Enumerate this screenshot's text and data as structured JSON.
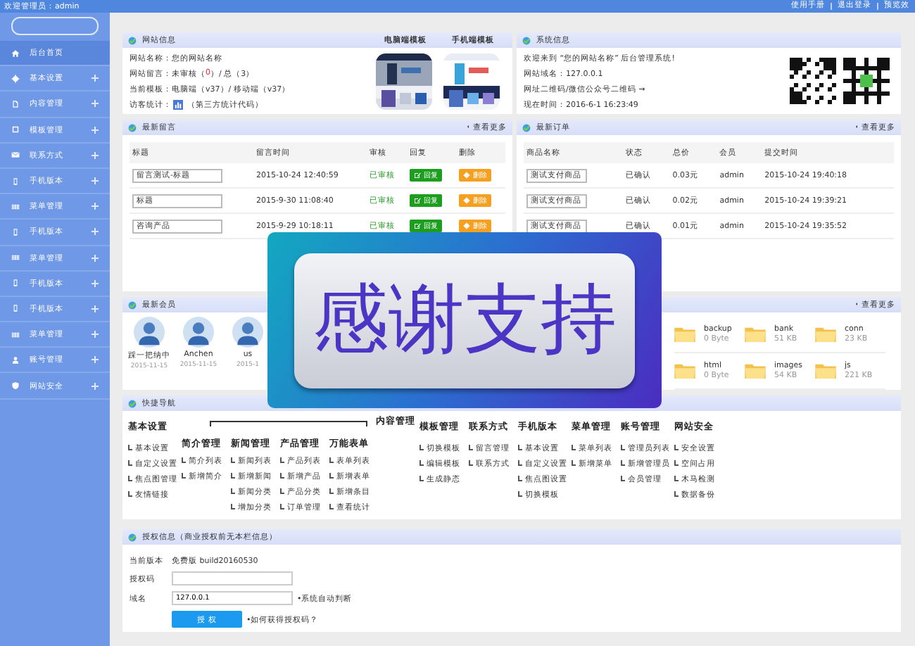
{
  "topbar": {
    "welcome": "欢迎管理员：admin",
    "links": [
      "使用手册",
      "退出登录",
      "预览效"
    ]
  },
  "sidebar": {
    "items": [
      {
        "label": "后台首页",
        "kind": "home",
        "selected": true,
        "expandable": false
      },
      {
        "label": "基本设置",
        "kind": "gear",
        "selected": false,
        "expandable": true
      },
      {
        "label": "内容管理",
        "kind": "document",
        "selected": false,
        "expandable": true
      },
      {
        "label": "模板管理",
        "kind": "frame",
        "selected": false,
        "expandable": true
      },
      {
        "label": "联系方式",
        "kind": "mail",
        "selected": false,
        "expandable": true
      },
      {
        "label": "手机版本",
        "kind": "phone",
        "selected": false,
        "expandable": true
      },
      {
        "label": "菜单管理",
        "kind": "grid",
        "selected": false,
        "expandable": true
      },
      {
        "label": "手机版本",
        "kind": "phone",
        "selected": false,
        "expandable": true
      },
      {
        "label": "菜单管理",
        "kind": "grid",
        "selected": false,
        "expandable": true
      },
      {
        "label": "手机版本",
        "kind": "phone",
        "selected": false,
        "expandable": true
      },
      {
        "label": "手机版本",
        "kind": "phone",
        "selected": false,
        "expandable": true
      },
      {
        "label": "菜单管理",
        "kind": "grid",
        "selected": false,
        "expandable": true
      },
      {
        "label": "账号管理",
        "kind": "user",
        "selected": false,
        "expandable": true
      },
      {
        "label": "网站安全",
        "kind": "shield",
        "selected": false,
        "expandable": true
      }
    ]
  },
  "site_info": {
    "title": "网站信息",
    "templates": [
      "电脑端模板",
      "手机端模板"
    ],
    "lines": [
      {
        "kind": "text",
        "segments": [
          {
            "text": "网站名称：您的网站名称",
            "alert": false
          }
        ]
      },
      {
        "kind": "text",
        "segments": [
          {
            "text": "网站留言：未审核（",
            "alert": false
          },
          {
            "text": "0",
            "alert": true
          },
          {
            "text": "）/ 总（3）",
            "alert": false
          }
        ]
      },
      {
        "kind": "text",
        "segments": [
          {
            "text": "当前模板：电脑端（v37）/ 移动端（v37）",
            "alert": false
          }
        ]
      },
      {
        "kind": "stats",
        "label": "访客统计：",
        "note": "（第三方统计代码）"
      }
    ]
  },
  "system_info": {
    "title": "系统信息",
    "lines": [
      "欢迎来到 “您的网站名称” 后台管理系统!",
      "网站域名：127.0.0.1",
      "网址二维码/微信公众号二维码 →",
      "现在时间：2016-6-1 16:23:49"
    ]
  },
  "messages": {
    "title": "最新留言",
    "more": "查看更多",
    "columns": [
      "标题",
      "留言时间",
      "审核",
      "回复",
      "删除"
    ],
    "rows": [
      {
        "title": "留言测试-标题",
        "time": "2015-10-24 12:40:59",
        "status": "已审核",
        "approved": true,
        "reply": "回复",
        "delete": "删除"
      },
      {
        "title": "标题",
        "time": "2015-9-30 11:08:40",
        "status": "已审核",
        "approved": true,
        "reply": "回复",
        "delete": "删除"
      },
      {
        "title": "咨询产品",
        "time": "2015-9-29 10:18:11",
        "status": "已审核",
        "approved": true,
        "reply": "回复",
        "delete": "删除"
      }
    ]
  },
  "orders": {
    "title": "最新订单",
    "more": "查看更多",
    "columns": [
      "商品名称",
      "状态",
      "总价",
      "会员",
      "提交时间"
    ],
    "rows": [
      {
        "product": "测试支付商品",
        "status": "已确认",
        "total": "0.03元",
        "member": "admin",
        "time": "2015-10-24 19:40:18"
      },
      {
        "product": "测试支付商品",
        "status": "已确认",
        "total": "0.02元",
        "member": "admin",
        "time": "2015-10-24 19:39:21"
      },
      {
        "product": "测试支付商品",
        "status": "已确认",
        "total": "0.01元",
        "member": "admin",
        "time": "2015-10-24 19:35:52"
      }
    ]
  },
  "members": {
    "title": "最新会员",
    "items": [
      {
        "name": "踩一把纳中",
        "date": "2015-11-15"
      },
      {
        "name": "Anchen",
        "date": "2015-11-15"
      },
      {
        "name": "us",
        "date": "2015-1"
      }
    ]
  },
  "files": {
    "more": "查看更多",
    "items": [
      {
        "name": "backup",
        "size": "0 Byte"
      },
      {
        "name": "bank",
        "size": "51 KB"
      },
      {
        "name": "conn",
        "size": "23 KB"
      },
      {
        "name": "html",
        "size": "0 Byte"
      },
      {
        "name": "images",
        "size": "54 KB"
      },
      {
        "name": "js",
        "size": "221 KB"
      }
    ]
  },
  "quick_nav": {
    "title": "快捷导航",
    "groups": [
      {
        "label": "基本设置",
        "items": [
          "基本设置",
          "自定义设置",
          "焦点图管理",
          "友情链接"
        ]
      },
      {
        "label": "内容管理",
        "children": [
          {
            "label": "简介管理",
            "items": [
              "简介列表",
              "新增简介"
            ]
          },
          {
            "label": "新闻管理",
            "items": [
              "新闻列表",
              "新增新闻",
              "新闻分类",
              "增加分类"
            ]
          },
          {
            "label": "产品管理",
            "items": [
              "产品列表",
              "新增产品",
              "产品分类",
              "订单管理"
            ]
          },
          {
            "label": "万能表单",
            "items": [
              "表单列表",
              "新增表单",
              "新增条目",
              "查看统计"
            ]
          }
        ]
      },
      {
        "label": "模板管理",
        "items": [
          "切换模板",
          "编辑模板",
          "生成静态"
        ]
      },
      {
        "label": "联系方式",
        "items": [
          "留言管理",
          "联系方式"
        ]
      },
      {
        "label": "手机版本",
        "items": [
          "基本设置",
          "自定义设置",
          "焦点图设置",
          "切换模板"
        ]
      },
      {
        "label": "菜单管理",
        "items": [
          "菜单列表",
          "新增菜单"
        ]
      },
      {
        "label": "账号管理",
        "items": [
          "管理员列表",
          "新增管理员",
          "会员管理"
        ]
      },
      {
        "label": "网站安全",
        "items": [
          "安全设置",
          "空间占用",
          "木马检测",
          "数据备份"
        ]
      }
    ]
  },
  "license": {
    "title": "授权信息（商业授权前无本栏信息）",
    "version_label": "当前版本",
    "version": "免费版 build20160530",
    "code_label": "授权码",
    "domain_label": "域名",
    "domain": "127.0.0.1",
    "domain_note": "•系统自动判断",
    "button": "授 权",
    "help": "•如何获得授权码？"
  },
  "overlay": {
    "text": "感谢支持"
  }
}
